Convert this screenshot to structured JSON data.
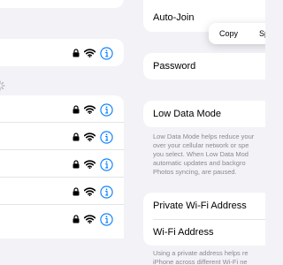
{
  "networks": {
    "known": [
      {
        "secured": true,
        "signal": "full"
      }
    ],
    "other": [
      {
        "secured": true,
        "signal": "full"
      },
      {
        "secured": true,
        "signal": "full"
      },
      {
        "secured": true,
        "signal": "full"
      },
      {
        "secured": true,
        "signal": "full"
      },
      {
        "secured": true,
        "signal": "full"
      }
    ]
  },
  "detail": {
    "auto_join_label": "Auto-Join",
    "password_label": "Password",
    "low_data_mode_label": "Low Data Mode",
    "low_data_mode_footnote": "Low Data Mode helps reduce your\nover your cellular network or spe\nyou select. When Low Data Mod\nautomatic updates and backgro\nPhotos syncing, are paused.",
    "private_address_label": "Private Wi-Fi Address",
    "wifi_address_label": "Wi-Fi Address",
    "private_address_footnote": "Using a private address helps re\niPhone across different Wi-Fi ne"
  },
  "popover": {
    "copy_label": "Copy",
    "share_label": "Sp"
  },
  "colors": {
    "accent": "#007aff",
    "background": "#f2f2f7",
    "card": "#ffffff",
    "secondary_text": "#8a8a8e"
  }
}
